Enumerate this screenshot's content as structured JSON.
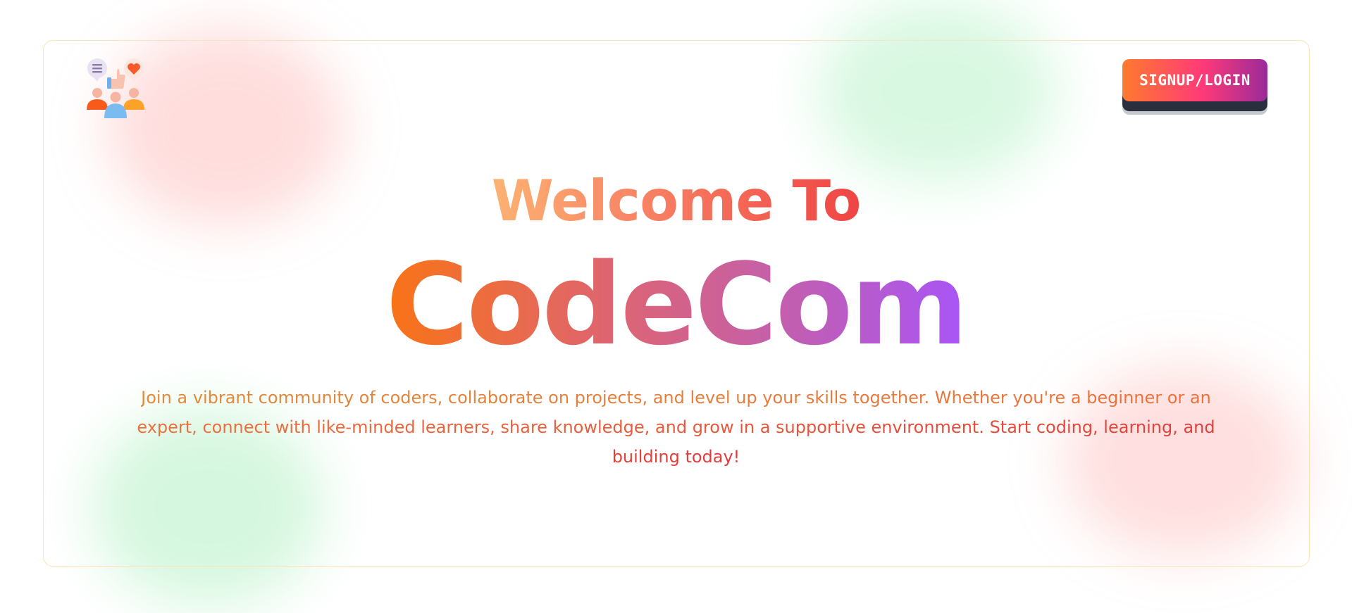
{
  "header": {
    "logo_icon": "community-people-thumbs-up-heart-icon",
    "signup_label": "SIGNUP/LOGIN"
  },
  "hero": {
    "welcome": "Welcome To",
    "brand": "CodeCom",
    "description": "Join a vibrant community of coders, collaborate on projects, and level up your skills together. Whether you're a beginner or an expert, connect with like-minded learners, share knowledge, and grow in a supportive environment. Start coding, learning, and building today!"
  },
  "colors": {
    "accent_orange": "#f97316",
    "accent_red": "#ef4444",
    "accent_purple": "#a855f7",
    "card_border": "#fde3b6"
  }
}
